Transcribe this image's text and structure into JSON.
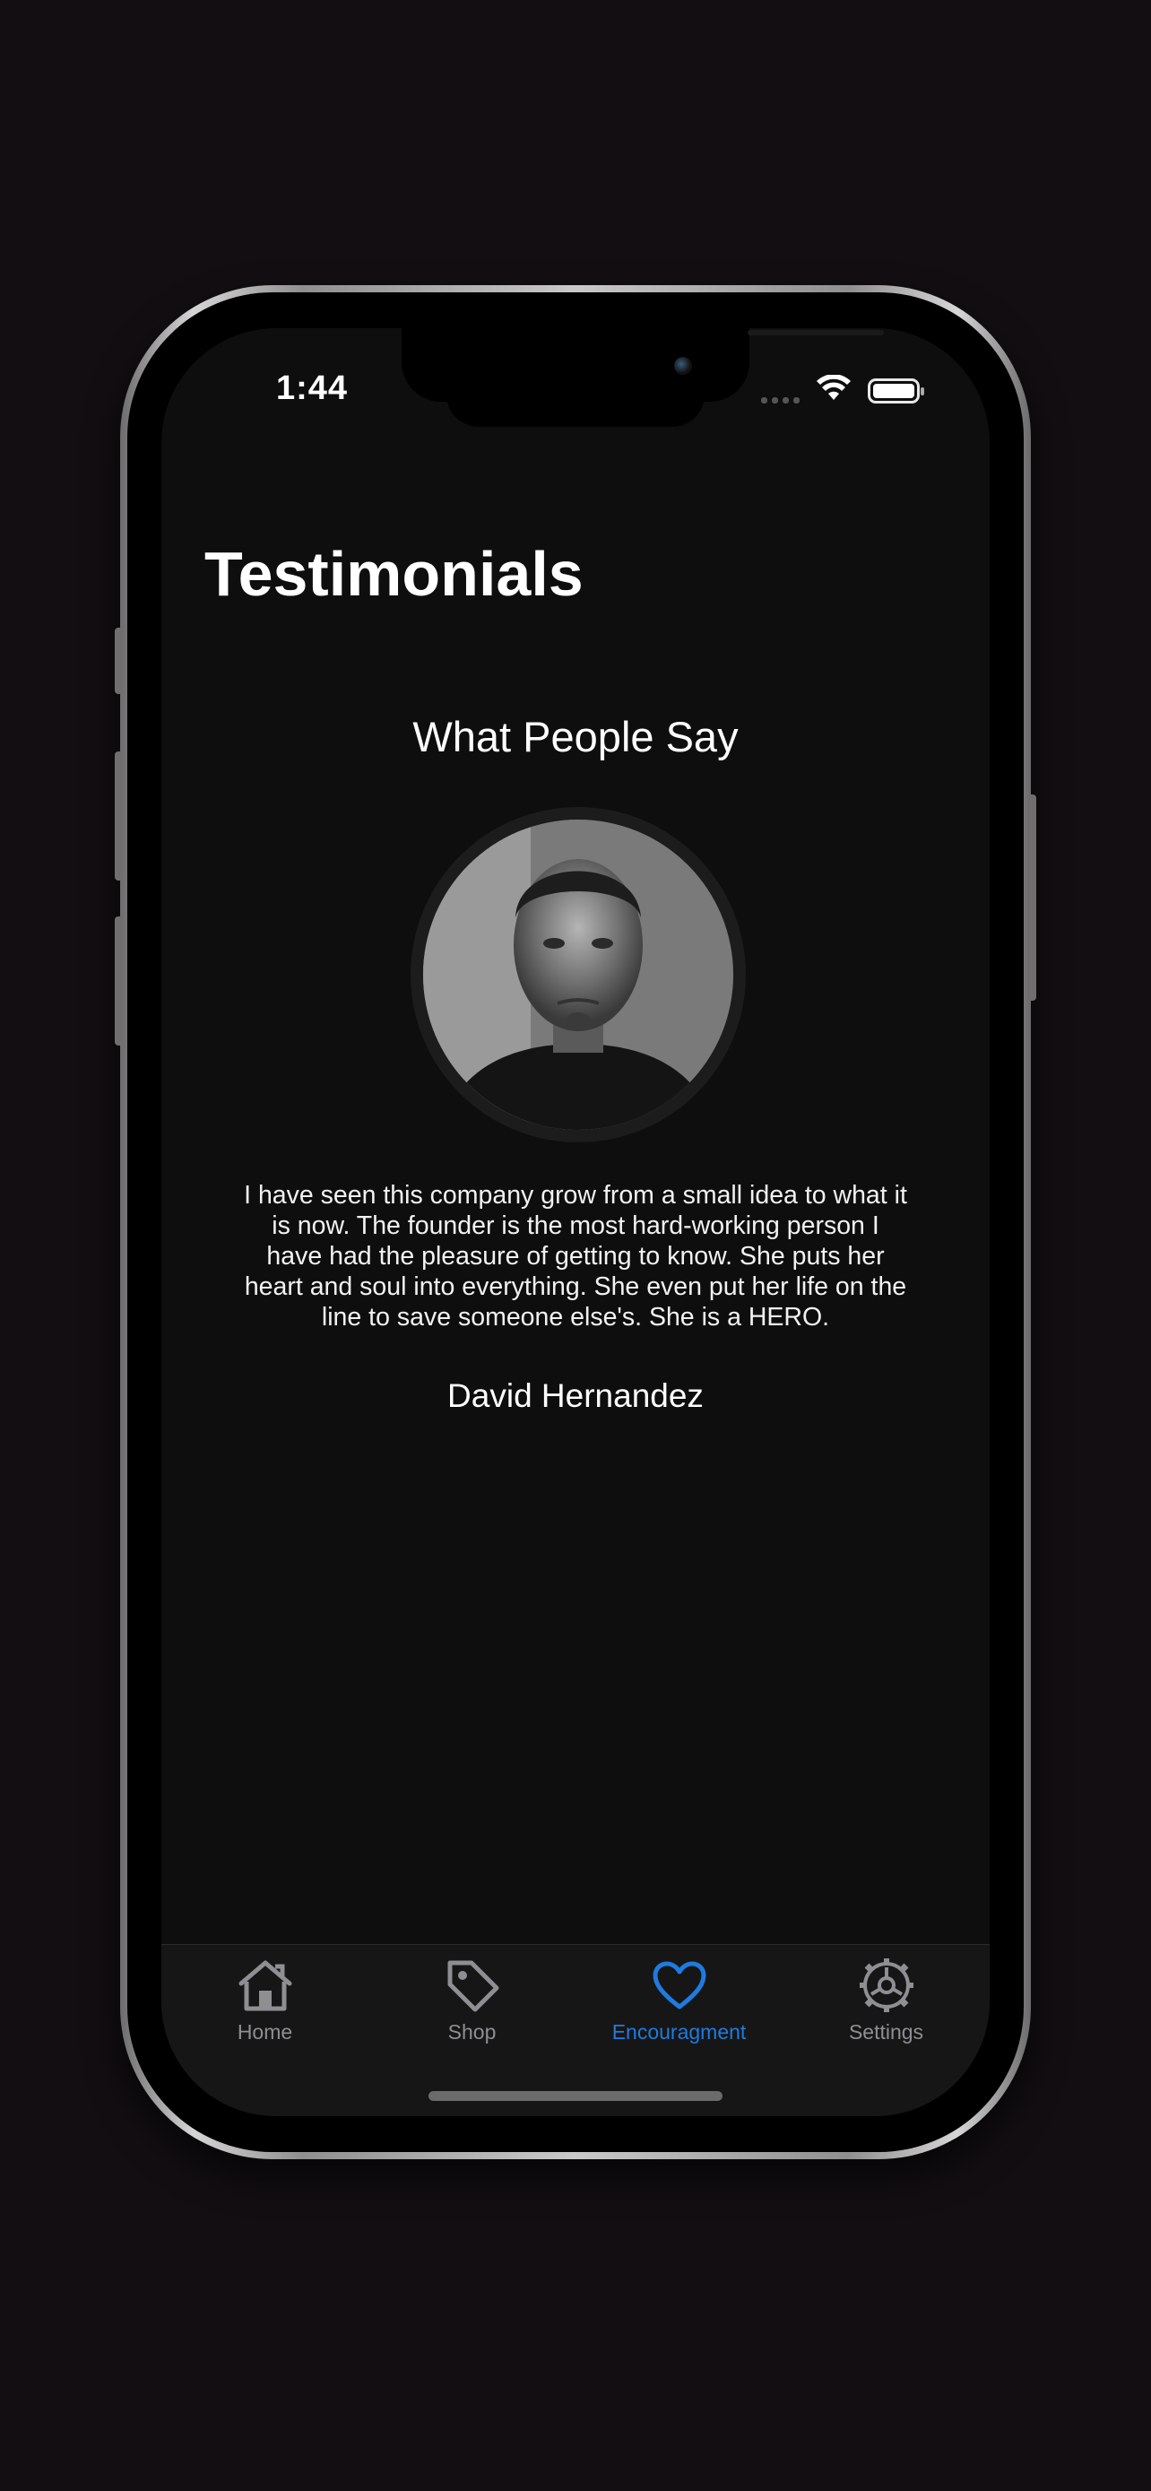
{
  "status_bar": {
    "time": "1:44"
  },
  "page": {
    "title": "Testimonials"
  },
  "testimonial": {
    "section_title": "What People Say",
    "quote": "I have seen this company grow from a small idea to what it is now. The founder is the most hard-working person I have had the pleasure of getting to know. She puts her heart and soul into everything. She even put her life on the line to save someone else's. She is a HERO.",
    "author": "David Hernandez"
  },
  "tab_bar": {
    "active_color": "#1e7be0",
    "inactive_color": "#8e8e93",
    "items": [
      {
        "label": "Home",
        "icon": "house-icon",
        "active": false
      },
      {
        "label": "Shop",
        "icon": "tag-icon",
        "active": false
      },
      {
        "label": "Encouragment",
        "icon": "heart-icon",
        "active": true
      },
      {
        "label": "Settings",
        "icon": "gear-icon",
        "active": false
      }
    ]
  }
}
